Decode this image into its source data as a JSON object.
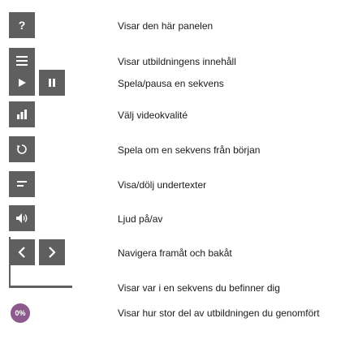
{
  "legend": {
    "help": "Visar den här panelen",
    "contents": "Visar utbildningens innehåll",
    "play_pause": "Spela/pausa en sekvens",
    "quality": "Välj videokvalité",
    "replay": "Spela om en sekvens från början",
    "subtitles": "Visa/dölj undertexter",
    "sound": "Ljud på/av",
    "navigate": "Navigera framåt och bakåt",
    "sequence_progress": "Visar var i en sekvens du befinner dig",
    "course_progress": "Visar hur stor del av utbildningen du genomfört"
  },
  "help_icon_glyph": "?",
  "course_progress_badge": "0%",
  "colors": {
    "button_bg": "#5f5f5f",
    "badge_bg": "#8c5a8c",
    "text": "#1a1a1a"
  },
  "icons": [
    "help-icon",
    "menu-list-icon",
    "play-icon",
    "pause-icon",
    "bar-chart-icon",
    "replay-icon",
    "subtitles-icon",
    "volume-icon",
    "arrow-left-icon",
    "arrow-right-icon"
  ]
}
